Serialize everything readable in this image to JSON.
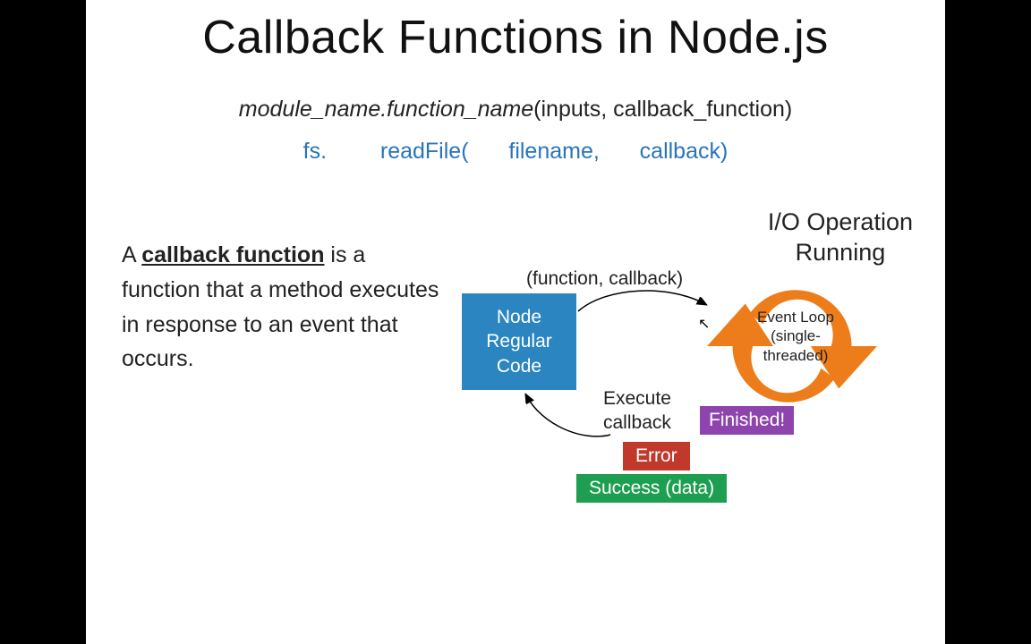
{
  "title": "Callback Functions in Node.js",
  "syntax_html": "module_name.function_name",
  "syntax_tail": "(inputs, callback_function)",
  "example": {
    "mod": "fs.",
    "func": "readFile(",
    "arg1": "filename,",
    "arg2": "callback)"
  },
  "definition_prefix": "A ",
  "definition_keyword": "callback function",
  "definition_rest": " is a function that a method executes in response to an event that occurs.",
  "diagram": {
    "io_title_line1": "I/O Operation",
    "io_title_line2": "Running",
    "func_callback": "(function, callback)",
    "node_box_line1": "Node",
    "node_box_line2": "Regular",
    "node_box_line3": "Code",
    "exec_cb_line1": "Execute",
    "exec_cb_line2": "callback",
    "finished": "Finished!",
    "error": "Error",
    "success": "Success (data)",
    "loop_label_line1": "Event Loop",
    "loop_label_line2": "(single-",
    "loop_label_line3": "threaded)"
  },
  "colors": {
    "blue_box": "#2a85c1",
    "purple": "#8e44ad",
    "red": "#c0392b",
    "green": "#1e9e50",
    "orange": "#ed7d1a",
    "code_blue": "#2a74b8"
  }
}
